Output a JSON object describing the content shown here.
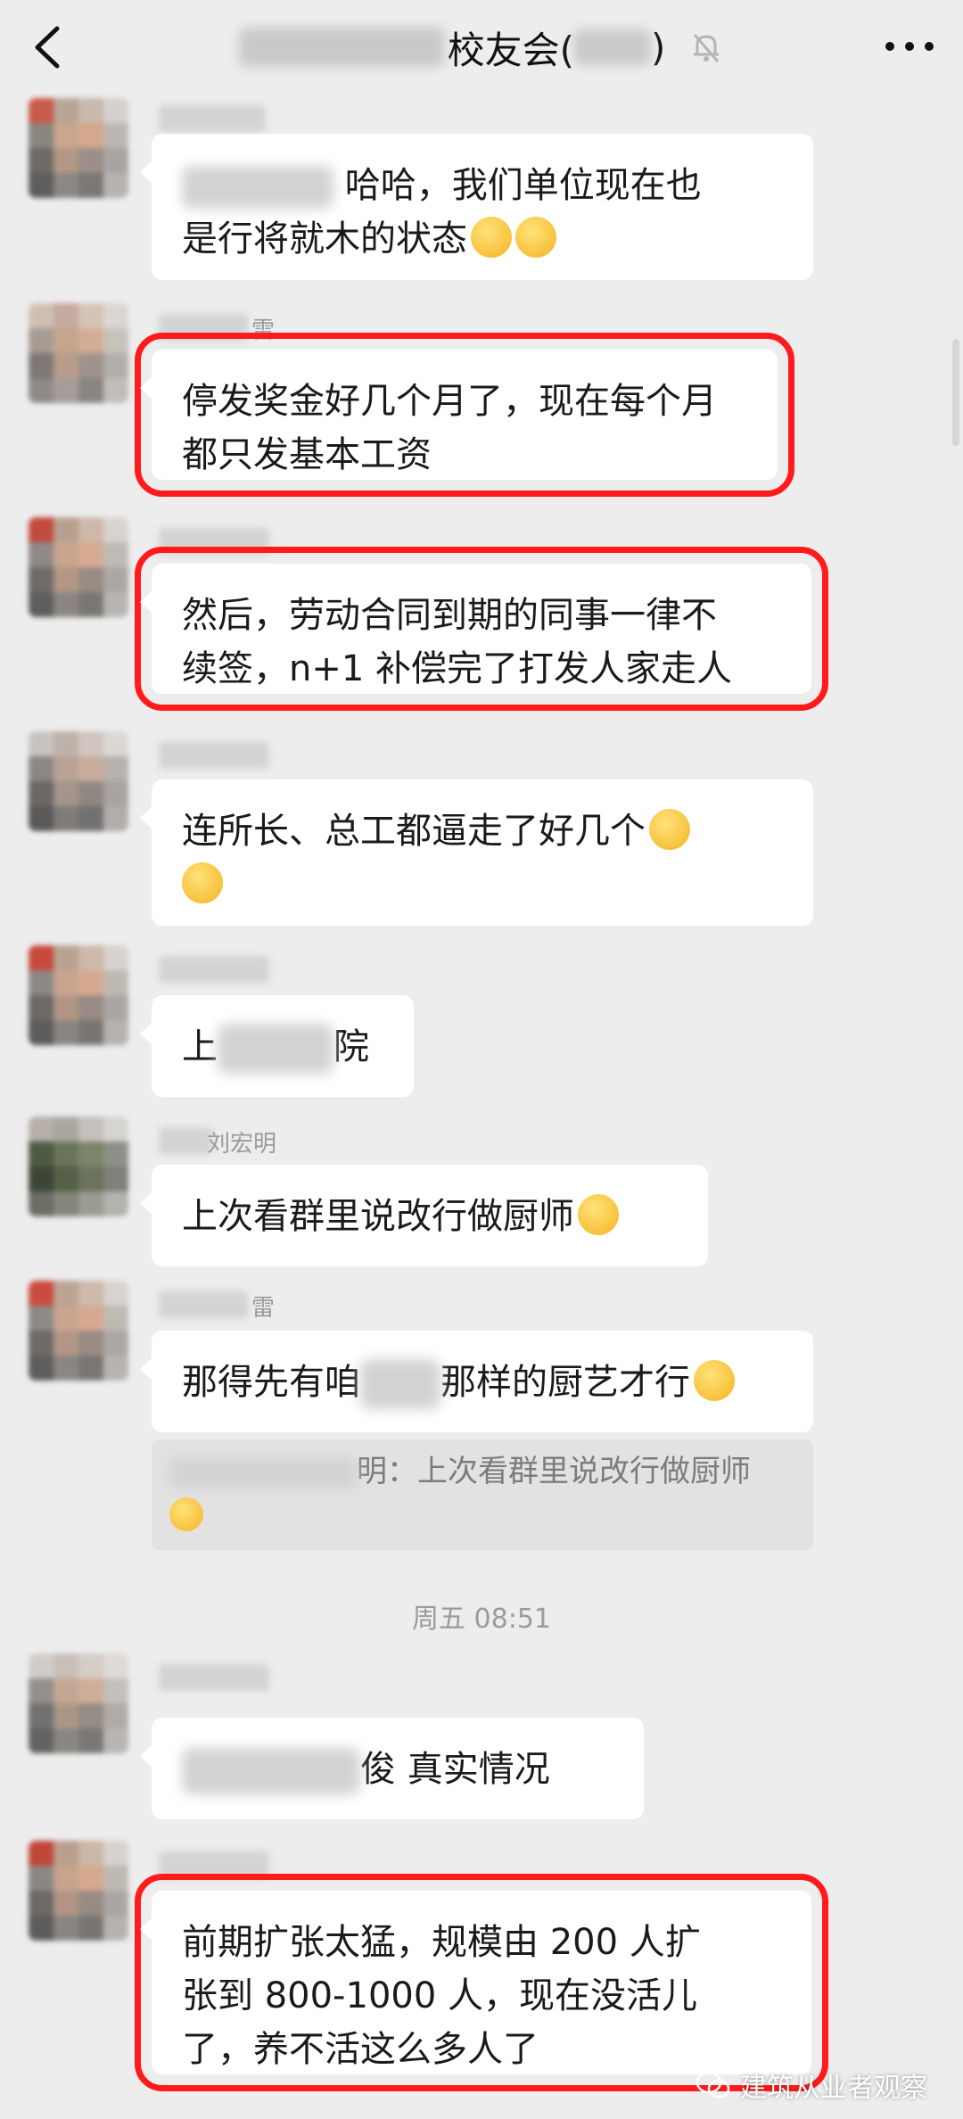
{
  "header": {
    "title_suffix": "校友会(",
    "title_close": ")",
    "back_icon": "chevron-left-icon",
    "mute_icon": "bell-off-icon",
    "more_icon": "more-dots-icon"
  },
  "messages": [
    {
      "nick_visible": "",
      "text": "哈哈，我们单位现在也是行将就木的状态",
      "line1": "哈哈，我们单位现在也",
      "line2": "是行将就木的状态"
    },
    {
      "nick_visible": "雷",
      "line1": "停发奖金好几个月了，现在每个月",
      "line2": "都只发基本工资"
    },
    {
      "nick_visible": "",
      "line1": "然后，劳动合同到期的同事一律不",
      "line2": "续签，n+1 补偿完了打发人家走人"
    },
    {
      "nick_visible": "",
      "line1": "连所长、总工都逼走了好几个",
      "line2": ""
    },
    {
      "nick_visible": "",
      "pre": "上",
      "post": "院"
    },
    {
      "nick_visible": "刘宏明",
      "line1": "上次看群里说改行做厨师"
    },
    {
      "nick_visible": "雷",
      "pre": "那得先有咱",
      "post": "那样的厨艺才行"
    },
    {
      "nick_visible": "",
      "pre": "",
      "post": "俊  真实情况"
    },
    {
      "nick_visible": "",
      "line1": "前期扩张太猛，规模由 200 人扩",
      "line2": "张到 800-1000 人，现在没活儿",
      "line3": "了，养不活这么多人了"
    }
  ],
  "quote": {
    "suffix": "明：上次看群里说改行做厨师"
  },
  "timestamp": "周五 08:51",
  "watermark": "建筑从业者观察",
  "colors": {
    "background": "#ededed",
    "bubble": "#ffffff",
    "highlight": "#ff1b1b",
    "quote_bg": "#e2e2e2"
  }
}
